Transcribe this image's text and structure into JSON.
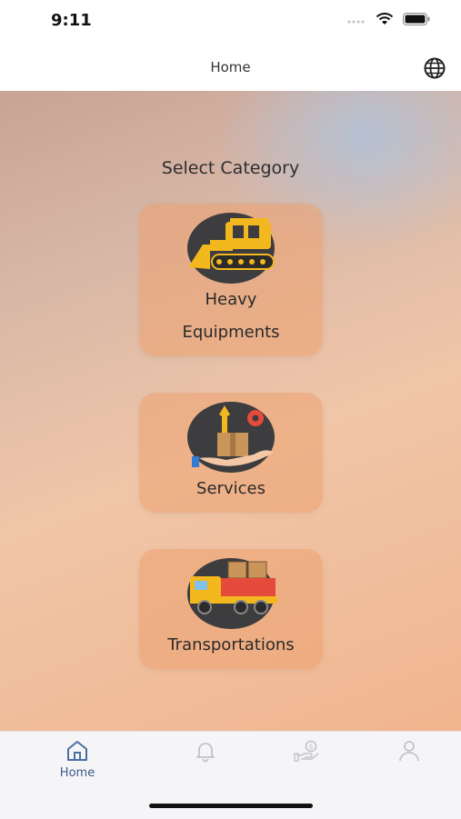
{
  "status_bar": {
    "time": "9:11"
  },
  "nav": {
    "title": "Home"
  },
  "content": {
    "heading": "Select Category",
    "categories": [
      {
        "label_line1": "Heavy",
        "label_line2": "Equipments",
        "icon": "bulldozer-icon"
      },
      {
        "label": "Services",
        "icon": "services-icon"
      },
      {
        "label": "Transportations",
        "icon": "truck-icon"
      }
    ]
  },
  "tab_bar": {
    "tabs": [
      {
        "label": "Home",
        "icon": "home-icon",
        "active": true
      },
      {
        "label": "",
        "icon": "bell-icon"
      },
      {
        "label": "",
        "icon": "payment-icon"
      },
      {
        "label": "",
        "icon": "user-icon"
      }
    ]
  },
  "colors": {
    "accent": "#3a5a8c",
    "card": "#eca070",
    "icon_bg": "#3d3d3f"
  }
}
